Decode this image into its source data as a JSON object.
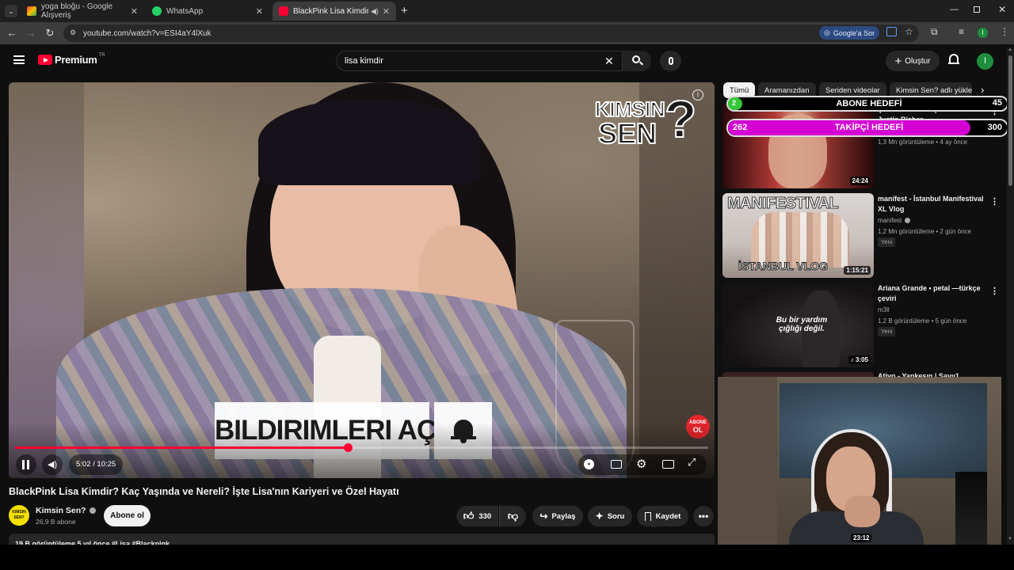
{
  "browser": {
    "tabs": [
      {
        "title": "yoga bloğu - Google Alışveriş",
        "active": false
      },
      {
        "title": "WhatsApp",
        "active": false
      },
      {
        "title": "BlackPink Lisa Kimdir? Kaç",
        "active": true
      }
    ],
    "url": "youtube.com/watch?v=ESI4aY4lXuk",
    "google_sor": "Google'a Sor",
    "profile_initial": "I"
  },
  "youtube": {
    "logo_text": "Premium",
    "logo_region": "TR",
    "search_value": "lisa kimdir",
    "create_label": "Oluştur",
    "avatar_initial": "I"
  },
  "video": {
    "overlay_kimsin": "KIMSIN",
    "overlay_sen": "SEN",
    "overlay_question": "?",
    "notif_banner": "BILDIRIMLERI AÇ",
    "abone_badge_top": "ABONE",
    "abone_badge_bottom": "OL",
    "time": "5:02 / 10:25",
    "progress": 0.48
  },
  "stream_goals": {
    "abone_label": "ABONE HEDEFİ",
    "abone_current": "2",
    "abone_target": "45",
    "takipci_label": "TAKİPÇİ HEDEFİ",
    "takipci_current": "262",
    "takipci_target": "300",
    "takipci_progress": 0.87
  },
  "watch": {
    "title": "BlackPink Lisa Kimdir? Kaç Yaşında ve Nereli? İşte Lisa'nın Kariyeri ve Özel Hayatı",
    "channel_name": "Kimsin Sen?",
    "channel_avatar_text": "KIMSIN SEN?",
    "subscribers": "26,9 B abone",
    "subscribe_label": "Abone ol",
    "likes": "330",
    "share_label": "Paylaş",
    "ask_label": "Soru",
    "save_label": "Kaydet",
    "description_peek": "19 B görüntüleme  5 yıl önce  #Lisa #Blackpink"
  },
  "filters": [
    "Tümü",
    "Aramanızdan",
    "Seriden videolar",
    "Kimsin Sen? adlı yükle"
  ],
  "recommendations": [
    {
      "title": "Şöhretin Korkunç Bedeli: Justin Bieber",
      "channel": "",
      "meta": "1,3 Mn görüntüleme • 4 ay önce",
      "duration": "24:24",
      "badge": ""
    },
    {
      "title": "manifest - İstanbul Manifestival XL Vlog",
      "channel": "manifest",
      "meta": "1,2 Mn görüntüleme • 2 gün önce",
      "duration": "1:15:21",
      "badge": "Yeni",
      "thumb_top": "MANIFESTIVAL",
      "thumb_bottom": "İSTANBUL VLOG"
    },
    {
      "title": "Ariana Grande • petal —türkçe çeviri",
      "channel": "m3ll",
      "meta": "1,2 B görüntüleme • 5 gün önce",
      "duration": "3:05",
      "badge": "Yeni",
      "thumb_text": "Bu bir yardım çığlığı değil."
    },
    {
      "title": "Ativo - Yapkesın | Sayıı1",
      "channel": "",
      "meta": "",
      "duration": "",
      "badge": ""
    }
  ],
  "webcam": {
    "timestamp": "23:12"
  },
  "colors": {
    "accent_red": "#ff0033",
    "goal_magenta": "#d400d4",
    "goal_green": "#37c83a"
  }
}
